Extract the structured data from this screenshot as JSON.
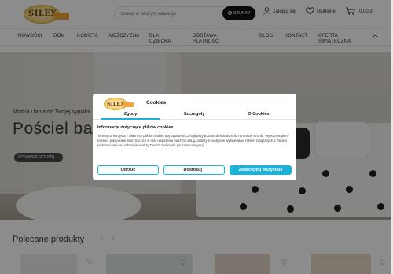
{
  "header": {
    "logo_text": "SILEX",
    "search": {
      "placeholder": "Szukaj w naszym katalogu",
      "button_label": "SZUKAJ"
    },
    "login_label": "Zaloguj się",
    "favorites_label": "Ulubione",
    "cart_label": "0,00 zł"
  },
  "nav": {
    "items": [
      {
        "label": "NOWOŚCI"
      },
      {
        "label": "DOM"
      },
      {
        "label": "KOBIETA"
      },
      {
        "label": "MĘŻCZYZNA"
      },
      {
        "label": "DLA DZIECKA"
      },
      {
        "label": "DOSTAWA I PŁATNOŚĆ"
      },
      {
        "label": "BLOG"
      },
      {
        "label": "KONTAKT"
      },
      {
        "label": "OFERTA ŚWIĄTECZNA"
      }
    ]
  },
  "hero": {
    "subtitle": "Modna i tania do Twojej sypialni",
    "title": "Pościel ba",
    "button_label": "SPRAWDŹ OFERTĘ"
  },
  "section": {
    "title": "Polecane produkty"
  },
  "cookie_modal": {
    "title": "Cookies",
    "tabs": [
      {
        "label": "Zgody"
      },
      {
        "label": "Szczegóły"
      },
      {
        "label": "O Cookies"
      }
    ],
    "heading": "Informacje dotyczące plików cookies",
    "body": "Ta witryna korzysta z własnych plików cookie, aby zapewnić Ci najlepszy poziom doświadczenia na naszej stronie. Wykorzystujemy również pliki cookie stron trzecich w celu ulepszenia naszych usług, analizy a następnie wyświetlania reklam związanych z Twoimi preferencjami na podstawie analizy Twoich zachowań podczas nawigacji.",
    "buttons": {
      "refuse": "Odrzuć",
      "customize": "Dostosuj",
      "accept": "Zaakceptuj wszystkie"
    }
  },
  "colors": {
    "accent": "#1db1d8",
    "dark": "#111111"
  }
}
